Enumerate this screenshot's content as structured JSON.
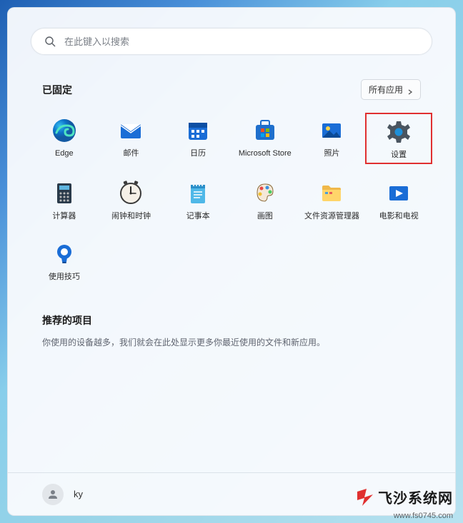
{
  "search": {
    "placeholder": "在此键入以搜索"
  },
  "pinned": {
    "title": "已固定",
    "all_apps": "所有应用",
    "apps": [
      {
        "id": "edge",
        "label": "Edge"
      },
      {
        "id": "mail",
        "label": "邮件"
      },
      {
        "id": "calendar",
        "label": "日历"
      },
      {
        "id": "store",
        "label": "Microsoft Store"
      },
      {
        "id": "photos",
        "label": "照片"
      },
      {
        "id": "settings",
        "label": "设置",
        "highlighted": true
      },
      {
        "id": "calculator",
        "label": "计算器"
      },
      {
        "id": "clock",
        "label": "闹钟和时钟"
      },
      {
        "id": "notepad",
        "label": "记事本"
      },
      {
        "id": "paint",
        "label": "画图"
      },
      {
        "id": "explorer",
        "label": "文件资源管理器"
      },
      {
        "id": "movies",
        "label": "电影和电视"
      },
      {
        "id": "tips",
        "label": "使用技巧"
      }
    ]
  },
  "recommended": {
    "title": "推荐的项目",
    "desc": "你使用的设备越多，我们就会在此处显示更多你最近使用的文件和新应用。"
  },
  "user": {
    "name": "ky"
  },
  "watermark": {
    "brand": "飞沙系统网",
    "url": "www.fs0745.com"
  }
}
